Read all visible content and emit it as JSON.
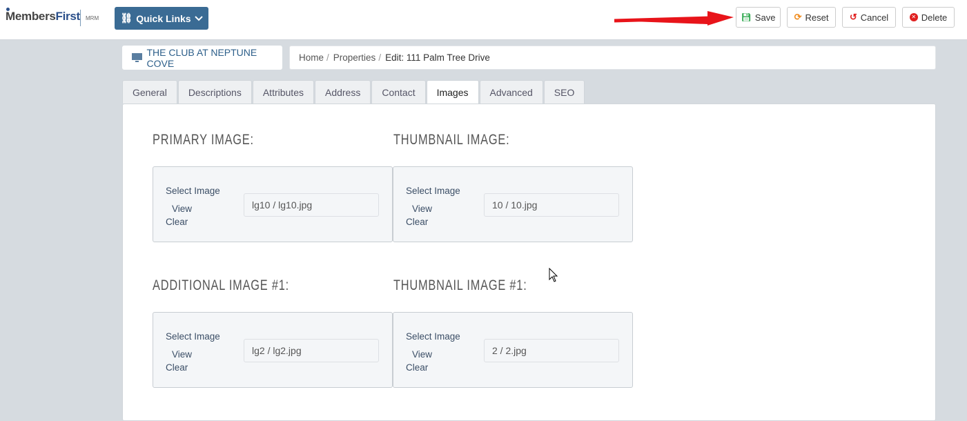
{
  "header": {
    "logo_text": "MembersFirst",
    "logo_sub": "MRM",
    "quick_links": "Quick Links",
    "actions": {
      "save": "Save",
      "reset": "Reset",
      "cancel": "Cancel",
      "delete": "Delete"
    }
  },
  "site_name": "THE CLUB AT NEPTUNE COVE",
  "breadcrumb": [
    "Home",
    "Properties",
    "Edit: 111 Palm Tree Drive"
  ],
  "tabs": [
    "General",
    "Descriptions",
    "Attributes",
    "Address",
    "Contact",
    "Images",
    "Advanced",
    "SEO"
  ],
  "active_tab": "Images",
  "images": [
    {
      "heading": "PRIMARY IMAGE:",
      "select": "Select Image",
      "view": "View",
      "clear": "Clear",
      "value": "lg10 / lg10.jpg"
    },
    {
      "heading": "THUMBNAIL IMAGE:",
      "select": "Select Image",
      "view": "View",
      "clear": "Clear",
      "value": "10 / 10.jpg"
    },
    {
      "heading": "ADDITIONAL IMAGE #1:",
      "select": "Select Image",
      "view": "View",
      "clear": "Clear",
      "value": "lg2 / lg2.jpg"
    },
    {
      "heading": "THUMBNAIL IMAGE #1:",
      "select": "Select Image",
      "view": "View",
      "clear": "Clear",
      "value": "2 / 2.jpg"
    }
  ],
  "colors": {
    "primary": "#3a6b94",
    "save": "#3cae5a",
    "reset": "#f08c1e",
    "cancel": "#e02020",
    "delete": "#e02020",
    "arrow": "#e8141a"
  }
}
